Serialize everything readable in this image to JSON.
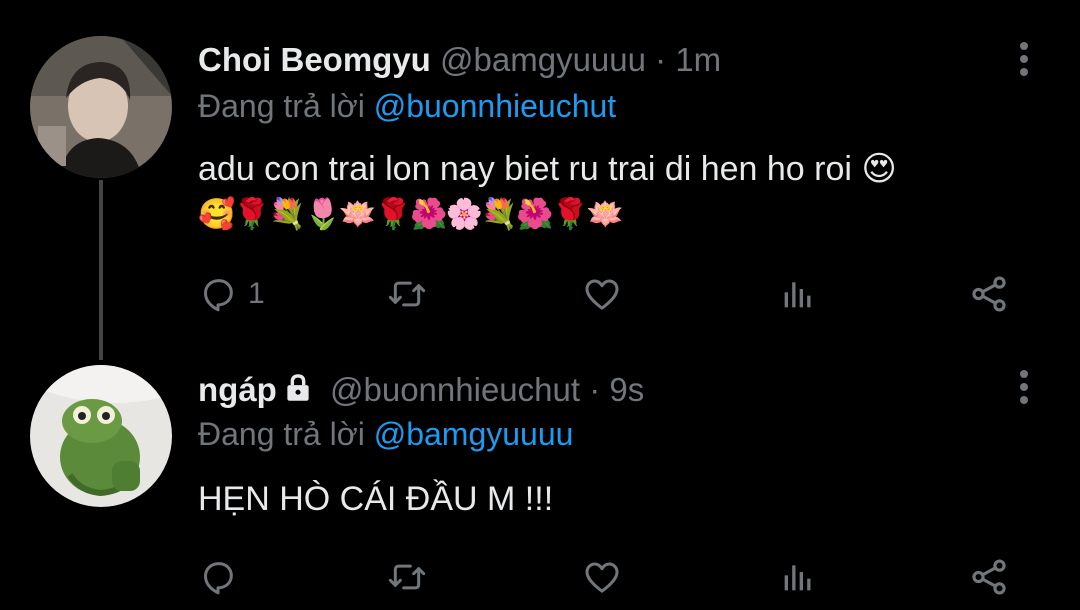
{
  "tweets": [
    {
      "display_name": "Choi Beomgyu",
      "handle": "@bamgyuuuu",
      "separator": "·",
      "time": "1m",
      "replying_prefix": "Đang trả lời",
      "replying_to": "@buonnhieuchut",
      "text": "adu con trai lon nay biet ru trai di hen ho roi 😍",
      "emoji_line": "🥰🌹💐🌷🪷🌹🌺🌸💐🌺🌹🪷",
      "reply_count": "1",
      "protected": false
    },
    {
      "display_name": "ngáp",
      "handle": "@buonnhieuchut",
      "separator": "·",
      "time": "9s",
      "replying_prefix": "Đang trả lời",
      "replying_to": "@bamgyuuuu",
      "text": "HẸN HÒ CÁI ĐẦU M !!!",
      "reply_count": "",
      "protected": true
    }
  ],
  "icons": {
    "reply": "reply-icon",
    "retweet": "retweet-icon",
    "like": "heart-icon",
    "stats": "stats-icon",
    "share": "share-icon",
    "more": "more-vertical-icon",
    "lock": "lock-icon"
  },
  "colors": {
    "background": "#000000",
    "text": "#e7e9ea",
    "muted": "#71767b",
    "link": "#1d9bf0"
  }
}
